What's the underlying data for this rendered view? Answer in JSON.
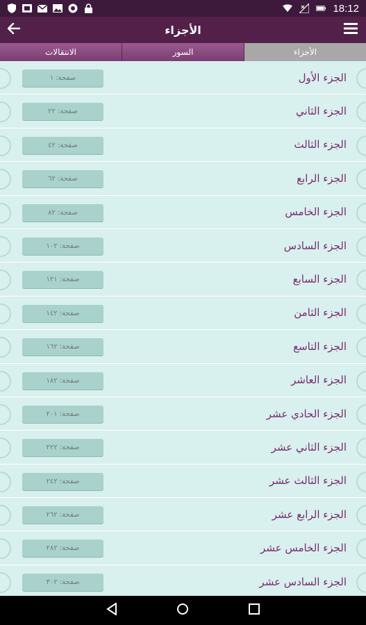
{
  "status_bar": {
    "time": "18:12"
  },
  "app_bar": {
    "title": "الأجزاء"
  },
  "tabs": [
    {
      "label": "الانتقالات"
    },
    {
      "label": "السور"
    },
    {
      "label": "الأجزاء"
    }
  ],
  "items": [
    {
      "label": "الجزء الأول",
      "page": "صفحة: ١"
    },
    {
      "label": "الجزء الثاني",
      "page": "صفحة: ٢٢"
    },
    {
      "label": "الجزء الثالث",
      "page": "صفحة: ٤٢"
    },
    {
      "label": "الجزء الرابع",
      "page": "صفحة: ٦٢"
    },
    {
      "label": "الجزء الخامس",
      "page": "صفحة: ٨٢"
    },
    {
      "label": "الجزء السادس",
      "page": "صفحة: ١٠٢"
    },
    {
      "label": "الجزء السابع",
      "page": "صفحة: ١٢١"
    },
    {
      "label": "الجزء الثامن",
      "page": "صفحة: ١٤٢"
    },
    {
      "label": "الجزء التاسع",
      "page": "صفحة: ١٦٢"
    },
    {
      "label": "الجزء العاشر",
      "page": "صفحة: ١٨٢"
    },
    {
      "label": "الجزء الحادي عشر",
      "page": "صفحة: ٢٠١"
    },
    {
      "label": "الجزء الثاني عشر",
      "page": "صفحة: ٢٢٢"
    },
    {
      "label": "الجزء الثالث عشر",
      "page": "صفحة: ٢٤٢"
    },
    {
      "label": "الجزء الرابع عشر",
      "page": "صفحة: ٢٦٢"
    },
    {
      "label": "الجزء الخامس عشر",
      "page": "صفحة: ٢٨٢"
    },
    {
      "label": "الجزء السادس عشر",
      "page": "صفحة: ٣٠٢"
    }
  ],
  "colors": {
    "primary": "#522049",
    "list_bg": "#d8f0ee",
    "label": "#7a2a6e",
    "page_btn": "#a9d2cc"
  }
}
